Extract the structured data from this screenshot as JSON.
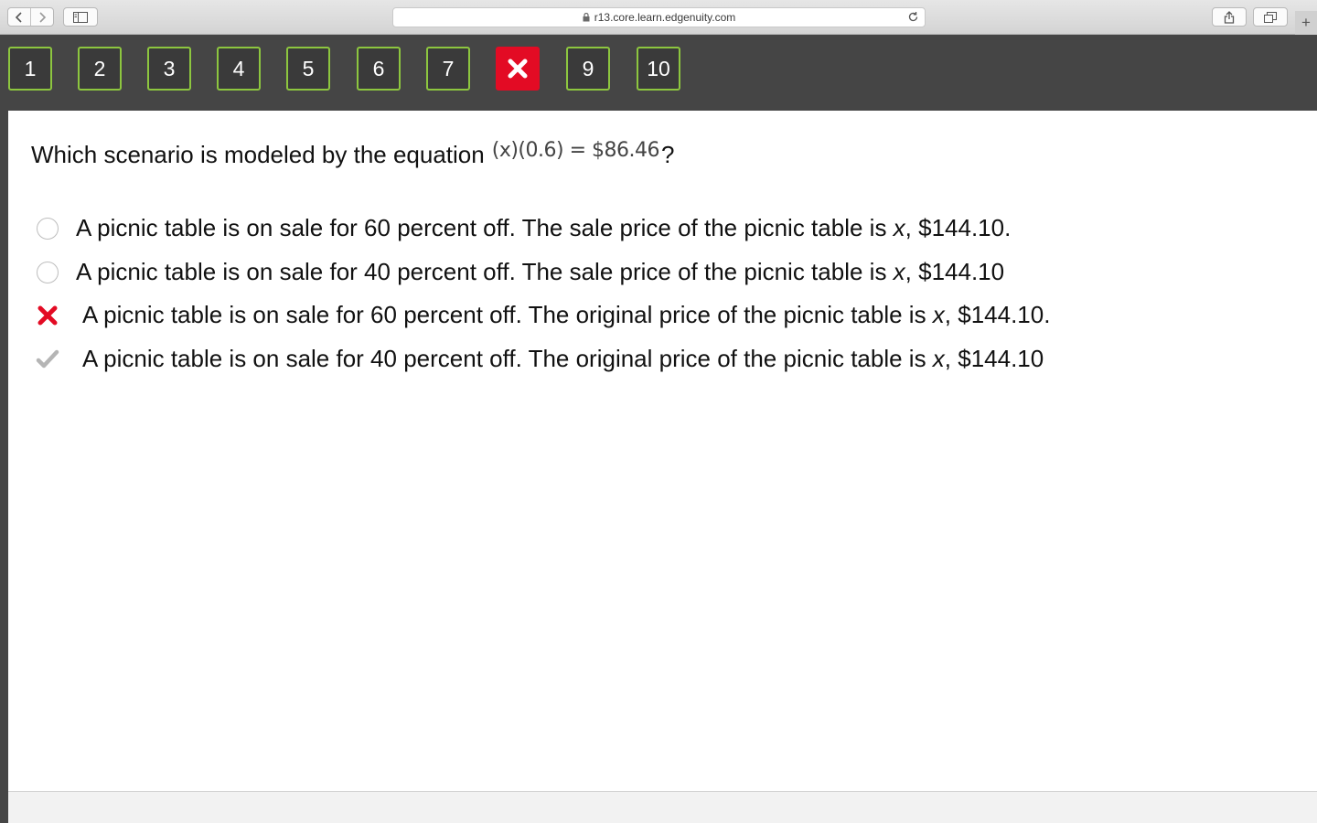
{
  "browser": {
    "url": "r13.core.learn.edgenuity.com"
  },
  "questions_nav": [
    {
      "label": "1",
      "status": "normal"
    },
    {
      "label": "2",
      "status": "normal"
    },
    {
      "label": "3",
      "status": "normal"
    },
    {
      "label": "4",
      "status": "normal"
    },
    {
      "label": "5",
      "status": "normal"
    },
    {
      "label": "6",
      "status": "normal"
    },
    {
      "label": "7",
      "status": "normal"
    },
    {
      "label": "",
      "status": "incorrect",
      "icon": "x-icon"
    },
    {
      "label": "9",
      "status": "normal"
    },
    {
      "label": "10",
      "status": "normal"
    }
  ],
  "question": {
    "prompt": "Which scenario is modeled by the equation",
    "equation": "(x)(0.6) = $86.46",
    "suffix": "?"
  },
  "options": [
    {
      "before": "A picnic table is on sale for 60 percent off. The sale price of the picnic table is ",
      "var": "x",
      "after": ", $144.10.",
      "state": "unselected"
    },
    {
      "before": "A picnic table is on sale for 40 percent off. The sale price of the picnic table is ",
      "var": "x",
      "after": ", $144.10",
      "state": "unselected"
    },
    {
      "before": "A picnic table is on sale for 60 percent off. The original price of the picnic table is ",
      "var": "x",
      "after": ", $144.10.",
      "state": "incorrect"
    },
    {
      "before": "A picnic table is on sale for 40 percent off. The original price of the picnic table is ",
      "var": "x",
      "after": ", $144.10",
      "state": "correct"
    }
  ],
  "colors": {
    "nav_border": "#8dc63f",
    "incorrect": "#e30b24",
    "correct_check": "#b5b5b5",
    "nav_bar": "#454545"
  }
}
